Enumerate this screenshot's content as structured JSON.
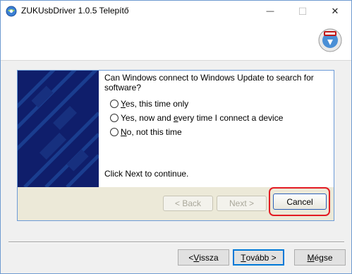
{
  "window": {
    "title": "ZUKUsbDriver 1.0.5 Telepítő",
    "app_icon": "installer-globe-icon",
    "header_icon": "setup-disc-icon"
  },
  "controls": {
    "minimize": "—",
    "maximize": "☐",
    "close": "✕"
  },
  "wizard": {
    "question_line1": "Can Windows connect to Windows Update to search for",
    "question_line2": "software?",
    "options": [
      {
        "prefix": "",
        "ul": "Y",
        "rest": "es, this time only"
      },
      {
        "prefix": "Yes, now and ",
        "ul": "e",
        "rest": "very time I connect a device"
      },
      {
        "prefix": "",
        "ul": "N",
        "rest": "o, not this time"
      }
    ],
    "continue_text": "Click Next to continue.",
    "back_label": "< Back",
    "next_label": "Next >",
    "cancel_label": "Cancel"
  },
  "footer": {
    "back": {
      "pre": "< ",
      "ul": "V",
      "rest": "issza"
    },
    "next": {
      "pre": "",
      "ul": "T",
      "rest": "ovább >"
    },
    "cancel": {
      "pre": "",
      "ul": "M",
      "rest": "égse"
    }
  },
  "colors": {
    "highlight": "#e31b23",
    "banner": "#0f1e6b",
    "focus": "#0078d7"
  }
}
